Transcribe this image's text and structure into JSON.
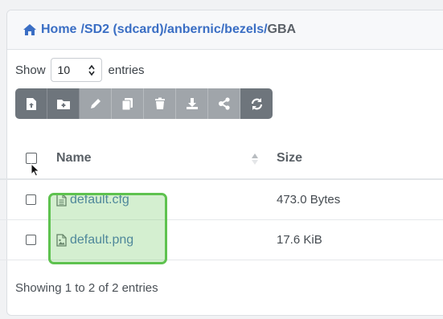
{
  "breadcrumb": {
    "home": "Home",
    "path": "/SD2 (sdcard)/anbernic/bezels/",
    "current": "GBA"
  },
  "length_control": {
    "prefix": "Show",
    "value": "10",
    "suffix": "entries"
  },
  "toolbar": {
    "buttons": [
      {
        "icon": "upload-file-icon",
        "state": "enabled"
      },
      {
        "icon": "new-folder-icon",
        "state": "enabled"
      },
      {
        "icon": "edit-icon",
        "state": "disabled"
      },
      {
        "icon": "copy-icon",
        "state": "disabled"
      },
      {
        "icon": "trash-icon",
        "state": "disabled"
      },
      {
        "icon": "download-icon",
        "state": "disabled"
      },
      {
        "icon": "share-icon",
        "state": "disabled"
      },
      {
        "icon": "refresh-icon",
        "state": "enabled"
      }
    ]
  },
  "table": {
    "columns": [
      "Name",
      "Size"
    ],
    "rows": [
      {
        "name": "default.cfg",
        "size": "473.0 Bytes",
        "type": "text-file-icon"
      },
      {
        "name": "default.png",
        "size": "17.6 KiB",
        "type": "image-file-icon"
      }
    ]
  },
  "info": "Showing 1 to 2 of 2 entries",
  "colors": {
    "link": "#3a6ec4",
    "toolbar": "#6e757c",
    "highlight": "#5ec24f"
  }
}
